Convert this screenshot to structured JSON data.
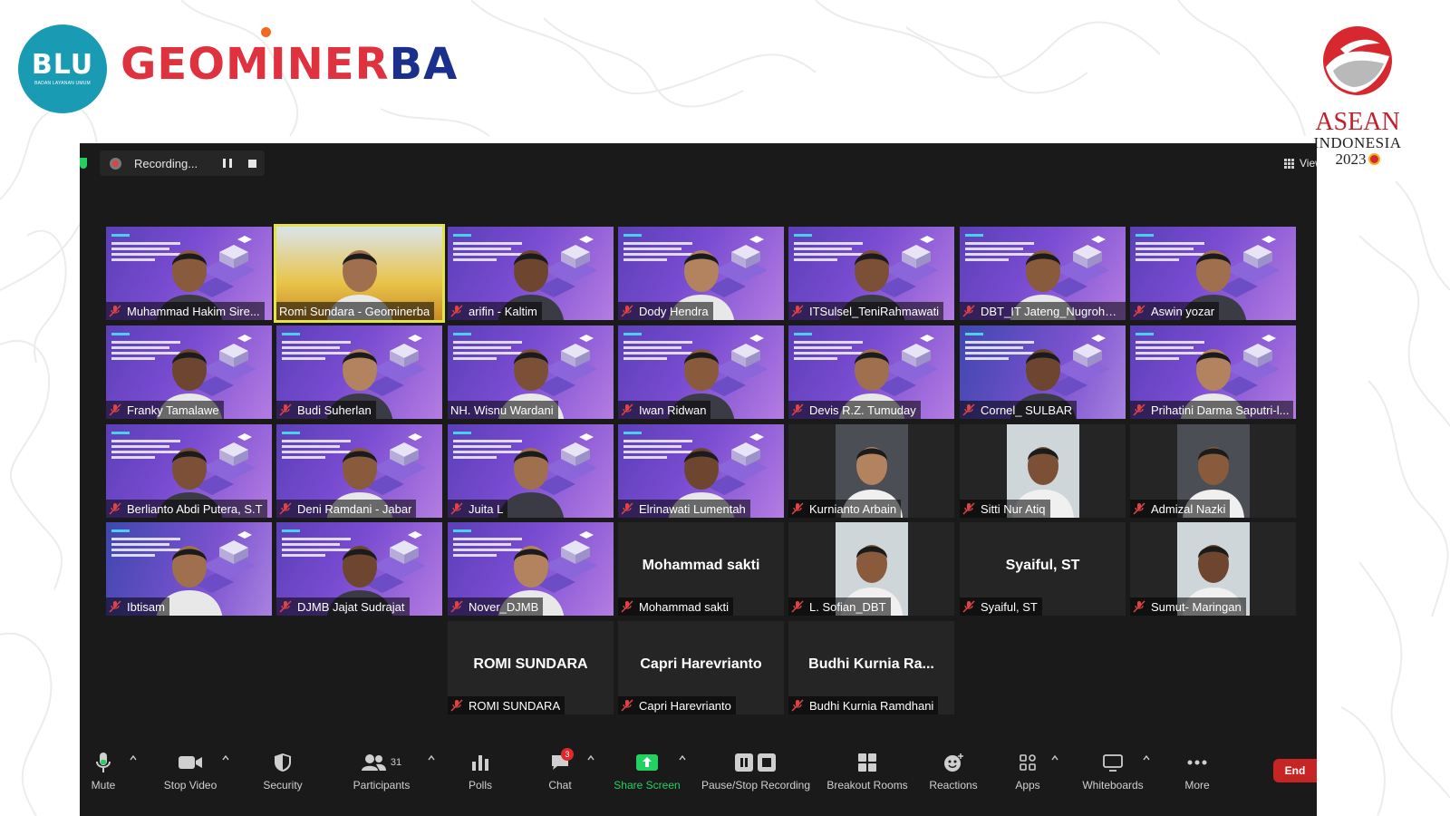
{
  "branding": {
    "blu_word": "BLU",
    "blu_sub": "BADAN LAYANAN UMUM",
    "brand_red": "GEOMINER",
    "brand_blue": "BA",
    "asean_title": "ASEAN",
    "asean_country": "INDONESIA",
    "asean_year": "2023",
    "colors": {
      "blu_teal": "#1a9bb4",
      "brand_red": "#e0313f",
      "brand_blue": "#1b2f8c",
      "asean_red": "#c3202b"
    }
  },
  "zoom": {
    "recording_label": "Recording...",
    "view_label": "View",
    "tiles": [
      {
        "name": "Muhammad Hakim Sire...",
        "muted": true,
        "bg": "slide"
      },
      {
        "name": "Romi Sundara - Geominerba",
        "muted": false,
        "bg": "construction",
        "active": true
      },
      {
        "name": "arifin - Kaltim",
        "muted": true,
        "bg": "slide"
      },
      {
        "name": "Dody Hendra",
        "muted": true,
        "bg": "slide"
      },
      {
        "name": "ITSulsel_TeniRahmawati",
        "muted": true,
        "bg": "slide"
      },
      {
        "name": "DBT_IT Jateng_Nugroho ...",
        "muted": true,
        "bg": "slide"
      },
      {
        "name": "Aswin yozar",
        "muted": true,
        "bg": "slide"
      },
      {
        "name": "Franky Tamalawe",
        "muted": true,
        "bg": "slide"
      },
      {
        "name": "Budi Suherlan",
        "muted": true,
        "bg": "slide"
      },
      {
        "name": "NH. Wisnu Wardani",
        "muted": false,
        "bg": "slide"
      },
      {
        "name": "Iwan Ridwan",
        "muted": true,
        "bg": "slide"
      },
      {
        "name": "Devis R.Z. Tumuday",
        "muted": true,
        "bg": "slide"
      },
      {
        "name": "Cornel_ SULBAR",
        "muted": true,
        "bg": "alt-slide"
      },
      {
        "name": "Prihatini Darma Saputri-l...",
        "muted": true,
        "bg": "slide"
      },
      {
        "name": "Berlianto Abdi Putera, S.T",
        "muted": true,
        "bg": "slide"
      },
      {
        "name": "Deni Ramdani - Jabar",
        "muted": true,
        "bg": "slide"
      },
      {
        "name": "Juita L",
        "muted": true,
        "bg": "slide"
      },
      {
        "name": "Elrinawati Lumentah",
        "muted": true,
        "bg": "slide"
      },
      {
        "name": "Kurnianto Arbain",
        "muted": true,
        "bg": "inset"
      },
      {
        "name": "Sitti Nur Atiq",
        "muted": true,
        "bg": "inset"
      },
      {
        "name": "Admizal Nazki",
        "muted": true,
        "bg": "inset"
      },
      {
        "name": "Ibtisam",
        "muted": true,
        "bg": "alt-slide"
      },
      {
        "name": "DJMB Jajat Sudrajat",
        "muted": true,
        "bg": "slide"
      },
      {
        "name": "Nover_DJMB",
        "muted": true,
        "bg": "slide"
      },
      {
        "name": "Mohammad sakti",
        "muted": true,
        "bg": "dark",
        "display": "Mohammad sakti"
      },
      {
        "name": "L. Sofian_DBT",
        "muted": true,
        "bg": "inset"
      },
      {
        "name": "Syaiful, ST",
        "muted": true,
        "bg": "dark",
        "display": "Syaiful, ST"
      },
      {
        "name": "Sumut- Maringan",
        "muted": true,
        "bg": "inset"
      },
      {
        "name": "ROMI SUNDARA",
        "muted": true,
        "bg": "dark",
        "display": "ROMI SUNDARA"
      },
      {
        "name": "Capri Harevrianto",
        "muted": true,
        "bg": "dark",
        "display": "Capri Harevrianto"
      },
      {
        "name": "Budhi Kurnia Ramdhani",
        "muted": true,
        "bg": "dark",
        "display": "Budhi Kurnia Ra..."
      }
    ],
    "toolbar": {
      "mute": "Mute",
      "stop_video": "Stop Video",
      "security": "Security",
      "participants": "Participants",
      "participants_count": "31",
      "polls": "Polls",
      "chat": "Chat",
      "chat_badge": "3",
      "share_screen": "Share Screen",
      "pause_stop_recording": "Pause/Stop Recording",
      "breakout_rooms": "Breakout Rooms",
      "reactions": "Reactions",
      "apps": "Apps",
      "whiteboards": "Whiteboards",
      "more": "More",
      "end": "End"
    },
    "colors": {
      "window_bg": "#1a1a1a",
      "tile_bg": "#262626",
      "active_speaker": "#e4e44a",
      "share_green": "#23d160",
      "end_red": "#c72424",
      "muted_red": "#e04343"
    }
  }
}
